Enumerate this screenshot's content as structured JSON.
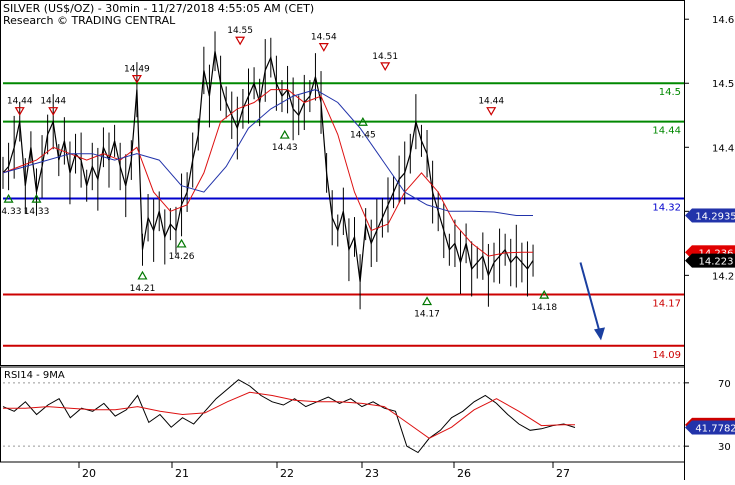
{
  "header": {
    "line1": "SILVER (US$/OZ) - 30min - 11/27/2018 4:55:05 AM (CET)",
    "line2": "Research © TRADING CENTRAL"
  },
  "colors": {
    "price": "#000000",
    "ma_fast": "#dd1111",
    "ma_slow": "#2233aa",
    "support": "#cc0000",
    "resistance": "#008800",
    "pivot": "#0000cc",
    "arrow": "#1a3fa0",
    "current_price_bg": "#000000",
    "ma_label_bg": "#e00000",
    "ma_slow_label_bg": "#2233aa",
    "rsi_bg": "#cc0000",
    "rsi_ma_bg": "#2233aa"
  },
  "chart_data": [
    {
      "type": "line",
      "title": "SILVER (US$/OZ) - 30min",
      "x_labels": [
        "20",
        "21",
        "22",
        "23",
        "26",
        "27"
      ],
      "ylim": [
        14.06,
        14.63
      ],
      "y_ticks": [
        14.2,
        14.3,
        14.4,
        14.5,
        14.6
      ],
      "series": [
        {
          "name": "",
          "x": [
            0,
            2,
            4,
            6,
            8,
            10,
            12,
            14,
            16,
            18,
            20,
            22,
            24,
            26,
            28,
            30,
            32,
            34,
            36,
            38,
            40,
            42,
            44,
            46,
            48,
            50,
            52,
            54,
            56,
            58,
            60,
            62,
            64,
            66,
            68,
            70,
            72,
            74,
            76,
            78,
            80,
            82,
            84,
            86,
            88,
            90,
            92,
            94,
            96,
            98,
            100,
            102,
            104,
            106,
            108,
            110,
            112,
            114,
            116,
            118,
            120,
            122,
            124,
            126,
            128,
            130,
            132,
            134,
            136,
            138,
            140,
            142,
            144,
            146,
            148,
            150,
            152,
            154,
            156,
            158,
            160,
            162,
            164,
            166,
            168,
            170,
            172,
            174,
            176,
            178,
            180,
            182,
            184,
            186,
            188,
            190
          ],
          "values": [
            14.36,
            14.37,
            14.4,
            14.44,
            14.34,
            14.4,
            14.33,
            14.37,
            14.42,
            14.44,
            14.38,
            14.41,
            14.36,
            14.39,
            14.38,
            14.34,
            14.37,
            14.35,
            14.4,
            14.38,
            14.41,
            14.37,
            14.34,
            14.38,
            14.49,
            14.24,
            14.29,
            14.27,
            14.3,
            14.26,
            14.28,
            14.27,
            14.31,
            14.33,
            14.38,
            14.42,
            14.52,
            14.48,
            14.55,
            14.5,
            14.47,
            14.45,
            14.43,
            14.46,
            14.48,
            14.5,
            14.47,
            14.52,
            14.54,
            14.5,
            14.48,
            14.49,
            14.46,
            14.45,
            14.47,
            14.48,
            14.51,
            14.47,
            14.36,
            14.29,
            14.27,
            14.3,
            14.24,
            14.26,
            14.19,
            14.28,
            14.25,
            14.27,
            14.29,
            14.31,
            14.33,
            14.35,
            14.36,
            14.39,
            14.44,
            14.41,
            14.39,
            14.33,
            14.3,
            14.27,
            14.24,
            14.25,
            14.22,
            14.25,
            14.21,
            14.22,
            14.23,
            14.2,
            14.22,
            14.23,
            14.24,
            14.22,
            14.23,
            14.22,
            14.21,
            14.223
          ]
        },
        {
          "name": "",
          "x": [
            0,
            6,
            12,
            18,
            24,
            30,
            36,
            42,
            48,
            54,
            60,
            66,
            72,
            78,
            84,
            90,
            96,
            102,
            108,
            114,
            120,
            126,
            132,
            138,
            144,
            150,
            156,
            162,
            168,
            174,
            180,
            186,
            190
          ],
          "values": [
            14.36,
            14.37,
            14.38,
            14.4,
            14.39,
            14.38,
            14.39,
            14.38,
            14.4,
            14.33,
            14.3,
            14.31,
            14.36,
            14.44,
            14.46,
            14.47,
            14.49,
            14.49,
            14.47,
            14.48,
            14.42,
            14.33,
            14.27,
            14.28,
            14.33,
            14.36,
            14.33,
            14.28,
            14.25,
            14.23,
            14.235,
            14.236,
            14.236
          ]
        },
        {
          "name": "",
          "x": [
            0,
            8,
            16,
            24,
            32,
            40,
            48,
            56,
            64,
            72,
            80,
            88,
            96,
            104,
            112,
            120,
            128,
            136,
            144,
            152,
            160,
            168,
            176,
            184,
            190
          ],
          "values": [
            14.36,
            14.37,
            14.38,
            14.39,
            14.39,
            14.38,
            14.39,
            14.38,
            14.34,
            14.33,
            14.37,
            14.43,
            14.46,
            14.48,
            14.49,
            14.47,
            14.43,
            14.38,
            14.33,
            14.31,
            14.3,
            14.3,
            14.299,
            14.2935,
            14.2935
          ]
        }
      ],
      "current_price": "14.223",
      "ma_fast_last": "14.236",
      "ma_slow_last": "14.2935",
      "levels": [
        {
          "value": 14.5,
          "label": "14.5",
          "kind": "resistance"
        },
        {
          "value": 14.44,
          "label": "14.44",
          "kind": "resistance"
        },
        {
          "value": 14.32,
          "label": "14.32",
          "kind": "pivot"
        },
        {
          "value": 14.17,
          "label": "14.17",
          "kind": "support"
        },
        {
          "value": 14.09,
          "label": "14.09",
          "kind": "support"
        }
      ],
      "annotations": [
        {
          "x": 2,
          "value": 14.33,
          "label": "14.33",
          "dir": "up"
        },
        {
          "x": 12,
          "value": 14.33,
          "label": "14.33",
          "dir": "up"
        },
        {
          "x": 6,
          "value": 14.44,
          "label": "14.44",
          "dir": "down"
        },
        {
          "x": 18,
          "value": 14.44,
          "label": "14.44",
          "dir": "down"
        },
        {
          "x": 48,
          "value": 14.49,
          "label": "14.49",
          "dir": "down"
        },
        {
          "x": 50,
          "value": 14.21,
          "label": "14.21",
          "dir": "up"
        },
        {
          "x": 64,
          "value": 14.26,
          "label": "14.26",
          "dir": "up"
        },
        {
          "x": 85,
          "value": 14.55,
          "label": "14.55",
          "dir": "down"
        },
        {
          "x": 101,
          "value": 14.43,
          "label": "14.43",
          "dir": "up"
        },
        {
          "x": 115,
          "value": 14.54,
          "label": "14.54",
          "dir": "down"
        },
        {
          "x": 129,
          "value": 14.45,
          "label": "14.45",
          "dir": "up"
        },
        {
          "x": 137,
          "value": 14.51,
          "label": "14.51",
          "dir": "down"
        },
        {
          "x": 152,
          "value": 14.17,
          "label": "14.17",
          "dir": "up"
        },
        {
          "x": 175,
          "value": 14.44,
          "label": "14.44",
          "dir": "down"
        },
        {
          "x": 194,
          "value": 14.18,
          "label": "14.18",
          "dir": "up"
        }
      ],
      "forecast_arrow": {
        "from": {
          "x": 207,
          "value": 14.22
        },
        "to": {
          "x": 214,
          "value": 14.1
        }
      }
    },
    {
      "type": "line",
      "title": "RSI14 - 9MA",
      "ylim": [
        20,
        80
      ],
      "y_ticks": [
        30,
        70
      ],
      "dotted_levels": [
        30,
        70
      ],
      "series": [
        {
          "name": "",
          "x": [
            0,
            4,
            8,
            12,
            16,
            20,
            24,
            28,
            32,
            36,
            40,
            44,
            48,
            52,
            56,
            60,
            64,
            68,
            72,
            76,
            80,
            84,
            88,
            92,
            96,
            100,
            104,
            108,
            112,
            116,
            120,
            124,
            128,
            132,
            136,
            140,
            144,
            148,
            152,
            156,
            160,
            164,
            168,
            172,
            176,
            180,
            184,
            188,
            192,
            196,
            200,
            204
          ],
          "values": [
            55,
            52,
            58,
            50,
            56,
            60,
            48,
            54,
            52,
            57,
            49,
            53,
            62,
            45,
            50,
            42,
            48,
            44,
            52,
            60,
            66,
            72,
            68,
            62,
            58,
            56,
            60,
            55,
            58,
            61,
            57,
            60,
            55,
            58,
            54,
            52,
            30,
            26,
            35,
            40,
            48,
            52,
            58,
            62,
            57,
            50,
            44,
            40,
            41,
            43,
            44,
            41.78
          ]
        },
        {
          "name": "",
          "x": [
            0,
            8,
            16,
            24,
            32,
            40,
            48,
            56,
            64,
            72,
            80,
            88,
            96,
            104,
            112,
            120,
            128,
            136,
            144,
            152,
            160,
            168,
            176,
            184,
            192,
            200,
            204
          ],
          "values": [
            54,
            54,
            55,
            54,
            53,
            53,
            55,
            52,
            50,
            51,
            58,
            64,
            62,
            59,
            58,
            58,
            57,
            55,
            45,
            35,
            42,
            53,
            60,
            52,
            43,
            43.5,
            43.48
          ]
        }
      ],
      "rsi_last": "41.7782",
      "ma_last": "43.4781"
    }
  ],
  "x_axis": {
    "labels": [
      "20",
      "21",
      "22",
      "23",
      "26",
      "27"
    ]
  }
}
